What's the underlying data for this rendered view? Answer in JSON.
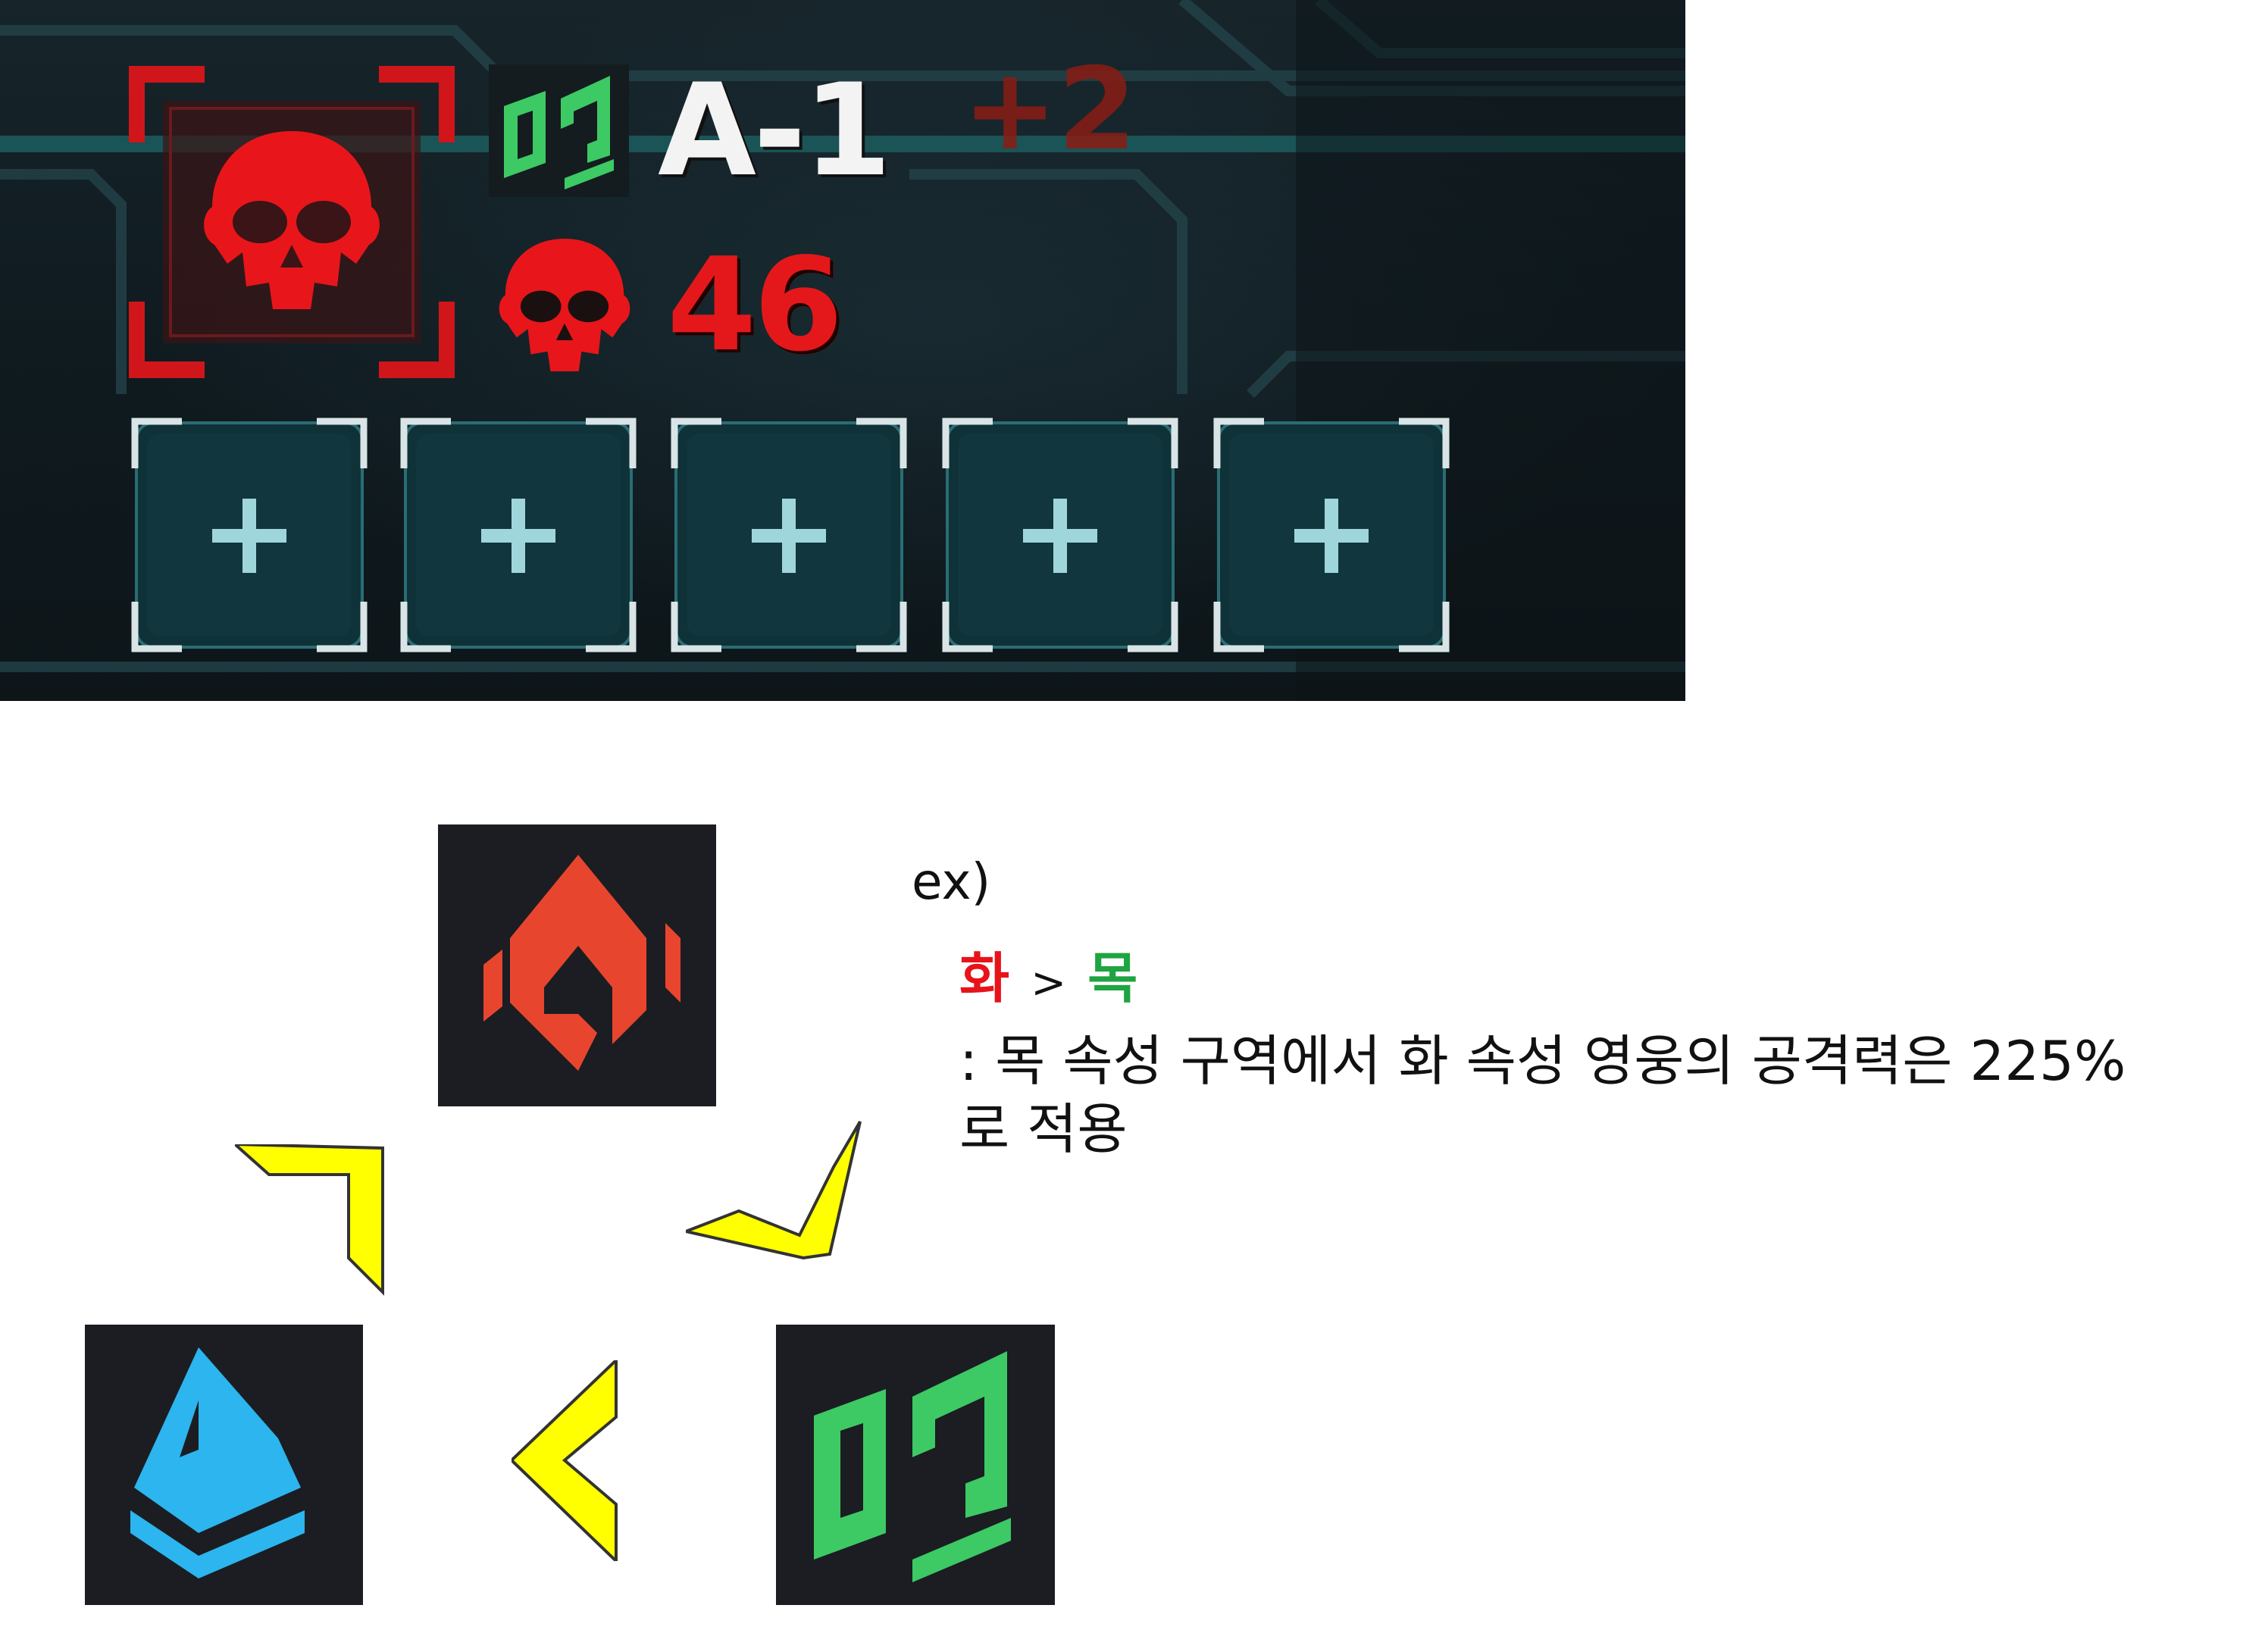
{
  "game_panel": {
    "stage": "A-1",
    "bonus": "+2",
    "enemy_count": "46",
    "enemy_icon": "skull-icon",
    "zone_element_icon": "wood-element-icon",
    "slots": [
      {
        "icon": "plus-icon"
      },
      {
        "icon": "plus-icon"
      },
      {
        "icon": "plus-icon"
      },
      {
        "icon": "plus-icon"
      },
      {
        "icon": "plus-icon"
      }
    ]
  },
  "diagram": {
    "elements": [
      {
        "name": "fire",
        "icon": "fire-element-icon",
        "color": "#e8452f"
      },
      {
        "name": "water",
        "icon": "water-element-icon",
        "color": "#2cb5ee"
      },
      {
        "name": "wood",
        "icon": "wood-element-icon",
        "color": "#3dc964"
      }
    ],
    "arrow_color": "#ffff00"
  },
  "example": {
    "prefix": "ex)",
    "strong": "화",
    "gt": ">",
    "weak": "목",
    "strong_color": "#e8131a",
    "weak_color": "#1fa442",
    "description": ": 목 속성 구역에서 화 속성 영웅의 공격력은 225%로 적용"
  }
}
